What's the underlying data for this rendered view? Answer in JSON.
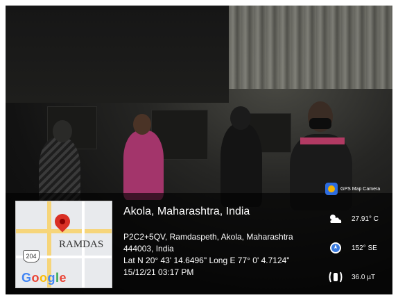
{
  "camera_brand": "GPS Map Camera",
  "location": {
    "title": "Akola, Maharashtra, India",
    "address_line1": "P2C2+5QV, Ramdaspeth, Akola, Maharashtra",
    "address_line2": "444003, India",
    "coordinates": "Lat N 20° 43' 14.6496\" Long E 77° 0' 4.7124\"",
    "datetime": "15/12/21 03:17 PM"
  },
  "map": {
    "place_label": "RAMDAS",
    "route_shield": "204",
    "logo_letters": [
      "G",
      "o",
      "o",
      "g",
      "l",
      "e"
    ],
    "logo_colors": [
      "#4285F4",
      "#EA4335",
      "#FBBC05",
      "#4285F4",
      "#34A853",
      "#EA4335"
    ],
    "pin_color": "#d93025"
  },
  "metrics": {
    "temperature": "27.91° C",
    "direction": "152° SE",
    "magnetic": "36.0 µT"
  },
  "icons": {
    "temperature": "cloud-sun-icon",
    "direction": "compass-icon",
    "magnetic": "magnet-field-icon",
    "camera": "gps-map-camera-icon",
    "pin": "map-pin-icon"
  }
}
